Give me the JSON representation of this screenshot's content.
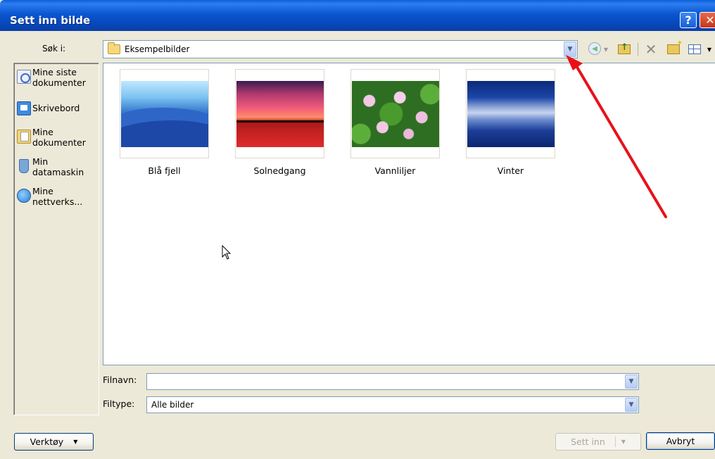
{
  "window": {
    "title": "Sett inn bilde",
    "help_glyph": "?",
    "close_glyph": "✕"
  },
  "look_in": {
    "label": "Søk i:",
    "value": "Eksempelbilder"
  },
  "toolbar": {
    "icons": [
      "back-icon",
      "up-one-level-icon",
      "delete-icon",
      "new-folder-icon",
      "views-icon"
    ]
  },
  "places": [
    {
      "label": "Mine siste dokumenter",
      "icon": "recent-documents-icon"
    },
    {
      "label": "Skrivebord",
      "icon": "desktop-icon"
    },
    {
      "label": "Mine dokumenter",
      "icon": "my-documents-icon"
    },
    {
      "label": "Min datamaskin",
      "icon": "my-computer-icon"
    },
    {
      "label": "Mine nettverks...",
      "icon": "network-places-icon"
    }
  ],
  "files": [
    {
      "name": "Blå fjell"
    },
    {
      "name": "Solnedgang"
    },
    {
      "name": "Vannliljer"
    },
    {
      "name": "Vinter"
    }
  ],
  "filename": {
    "label": "Filnavn:",
    "value": ""
  },
  "filetype": {
    "label": "Filtype:",
    "value": "Alle bilder"
  },
  "buttons": {
    "tools": "Verktøy",
    "insert": "Sett inn",
    "cancel": "Avbryt"
  },
  "colors": {
    "titlebar": "#0a56d0",
    "dialog_bg": "#ece9d8",
    "annotation_arrow": "#e8111b"
  }
}
